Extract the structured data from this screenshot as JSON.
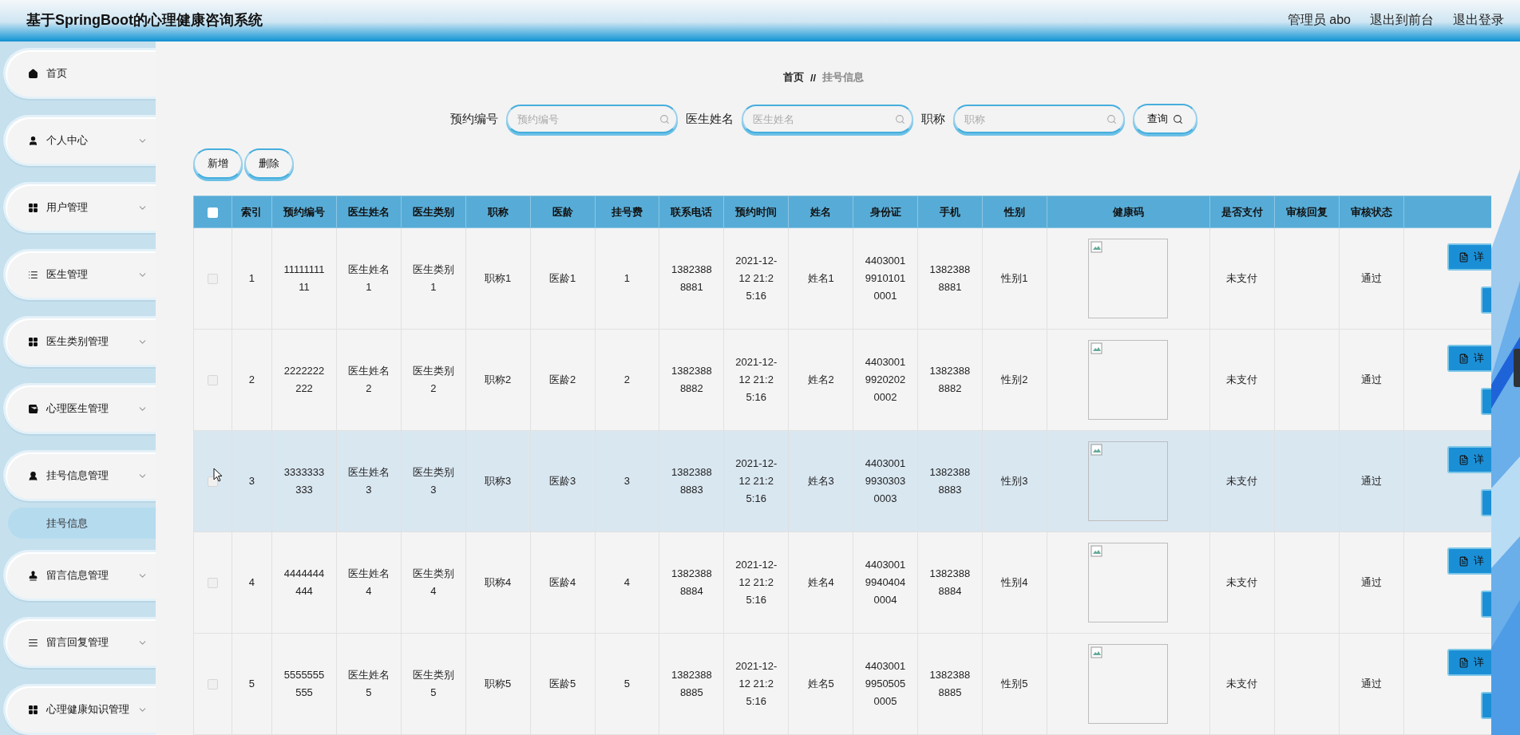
{
  "header": {
    "title": "基于SpringBoot的心理健康咨询系统",
    "user": "管理员 abo",
    "links": [
      "退出到前台",
      "退出登录"
    ]
  },
  "sidebar": {
    "items": [
      {
        "label": "首页",
        "expandable": false
      },
      {
        "label": "个人中心",
        "expandable": true
      },
      {
        "label": "用户管理",
        "expandable": true
      },
      {
        "label": "医生管理",
        "expandable": true
      },
      {
        "label": "医生类别管理",
        "expandable": true
      },
      {
        "label": "心理医生管理",
        "expandable": true
      },
      {
        "label": "挂号信息管理",
        "expandable": true,
        "children": [
          {
            "label": "挂号信息",
            "selected": true
          }
        ]
      },
      {
        "label": "留言信息管理",
        "expandable": true
      },
      {
        "label": "留言回复管理",
        "expandable": true
      },
      {
        "label": "心理健康知识管理",
        "expandable": true
      }
    ]
  },
  "breadcrumb": {
    "home": "首页",
    "separator": "//",
    "current": "挂号信息"
  },
  "search": {
    "fields": [
      {
        "label": "预约编号",
        "placeholder": "预约编号"
      },
      {
        "label": "医生姓名",
        "placeholder": "医生姓名"
      },
      {
        "label": "职称",
        "placeholder": "职称"
      }
    ],
    "button": "查询"
  },
  "actions": [
    "新增",
    "删除"
  ],
  "table": {
    "select_all": {
      "checked": false
    },
    "columns": [
      {
        "label": "索引",
        "kind": "text"
      },
      {
        "label": "预约编号",
        "kind": "text"
      },
      {
        "label": "医生姓名",
        "kind": "text"
      },
      {
        "label": "医生类别",
        "kind": "text"
      },
      {
        "label": "职称",
        "kind": "text"
      },
      {
        "label": "医龄",
        "kind": "text"
      },
      {
        "label": "挂号费",
        "kind": "text"
      },
      {
        "label": "联系电话",
        "kind": "text"
      },
      {
        "label": "预约时间",
        "kind": "text"
      },
      {
        "label": "姓名",
        "kind": "text"
      },
      {
        "label": "身份证",
        "kind": "text"
      },
      {
        "label": "手机",
        "kind": "text"
      },
      {
        "label": "性别",
        "kind": "text"
      },
      {
        "label": "健康码",
        "kind": "image"
      },
      {
        "label": "是否支付",
        "kind": "text"
      },
      {
        "label": "审核回复",
        "kind": "text"
      },
      {
        "label": "审核状态",
        "kind": "text"
      }
    ],
    "rows": [
      {
        "checked": false,
        "highlighted": false,
        "cells": [
          "1",
          "1111111111",
          "医生姓名1",
          "医生类别1",
          "职称1",
          "医龄1",
          "1",
          "13823888881",
          "2021-12-12 21:25:16",
          "姓名1",
          "440300199101010001",
          "13823888881",
          "性别1",
          null,
          "未支付",
          null,
          "通过"
        ],
        "action": "详"
      },
      {
        "checked": false,
        "highlighted": false,
        "cells": [
          "2",
          "2222222222",
          "医生姓名2",
          "医生类别2",
          "职称2",
          "医龄2",
          "2",
          "13823888882",
          "2021-12-12 21:25:16",
          "姓名2",
          "440300199202020002",
          "13823888882",
          "性别2",
          null,
          "未支付",
          null,
          "通过"
        ],
        "action": "详"
      },
      {
        "checked": false,
        "highlighted": true,
        "cells": [
          "3",
          "3333333333",
          "医生姓名3",
          "医生类别3",
          "职称3",
          "医龄3",
          "3",
          "13823888883",
          "2021-12-12 21:25:16",
          "姓名3",
          "440300199303030003",
          "13823888883",
          "性别3",
          null,
          "未支付",
          null,
          "通过"
        ],
        "action": "详"
      },
      {
        "checked": false,
        "highlighted": false,
        "cells": [
          "4",
          "4444444444",
          "医生姓名4",
          "医生类别4",
          "职称4",
          "医龄4",
          "4",
          "13823888884",
          "2021-12-12 21:25:16",
          "姓名4",
          "440300199404040004",
          "13823888884",
          "性别4",
          null,
          "未支付",
          null,
          "通过"
        ],
        "action": "详"
      },
      {
        "checked": false,
        "highlighted": false,
        "cells": [
          "5",
          "5555555555",
          "医生姓名5",
          "医生类别5",
          "职称5",
          "医龄5",
          "5",
          "13823888885",
          "2021-12-12 21:25:16",
          "姓名5",
          "440300199505050005",
          "13823888885",
          "性别5",
          null,
          "未支付",
          null,
          "通过"
        ],
        "action": "详"
      }
    ]
  }
}
